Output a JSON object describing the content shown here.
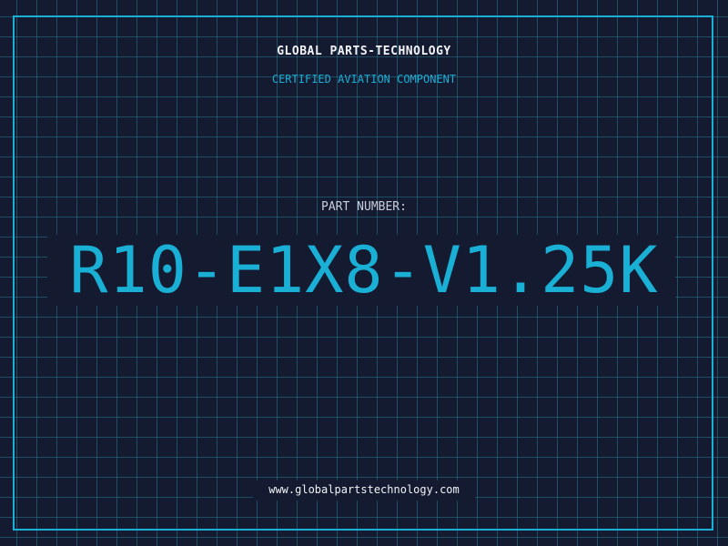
{
  "header": {
    "company": "GLOBAL PARTS-TECHNOLOGY",
    "tagline": "CERTIFIED AVIATION COMPONENT"
  },
  "main": {
    "label": "PART NUMBER:",
    "part_number": "R10-E1X8-V1.25K"
  },
  "footer": {
    "url": "www.globalpartstechnology.com"
  },
  "colors": {
    "background": "#141a30",
    "grid": "#26788c",
    "accent": "#1ab0d6",
    "text": "#f2f4f8"
  }
}
